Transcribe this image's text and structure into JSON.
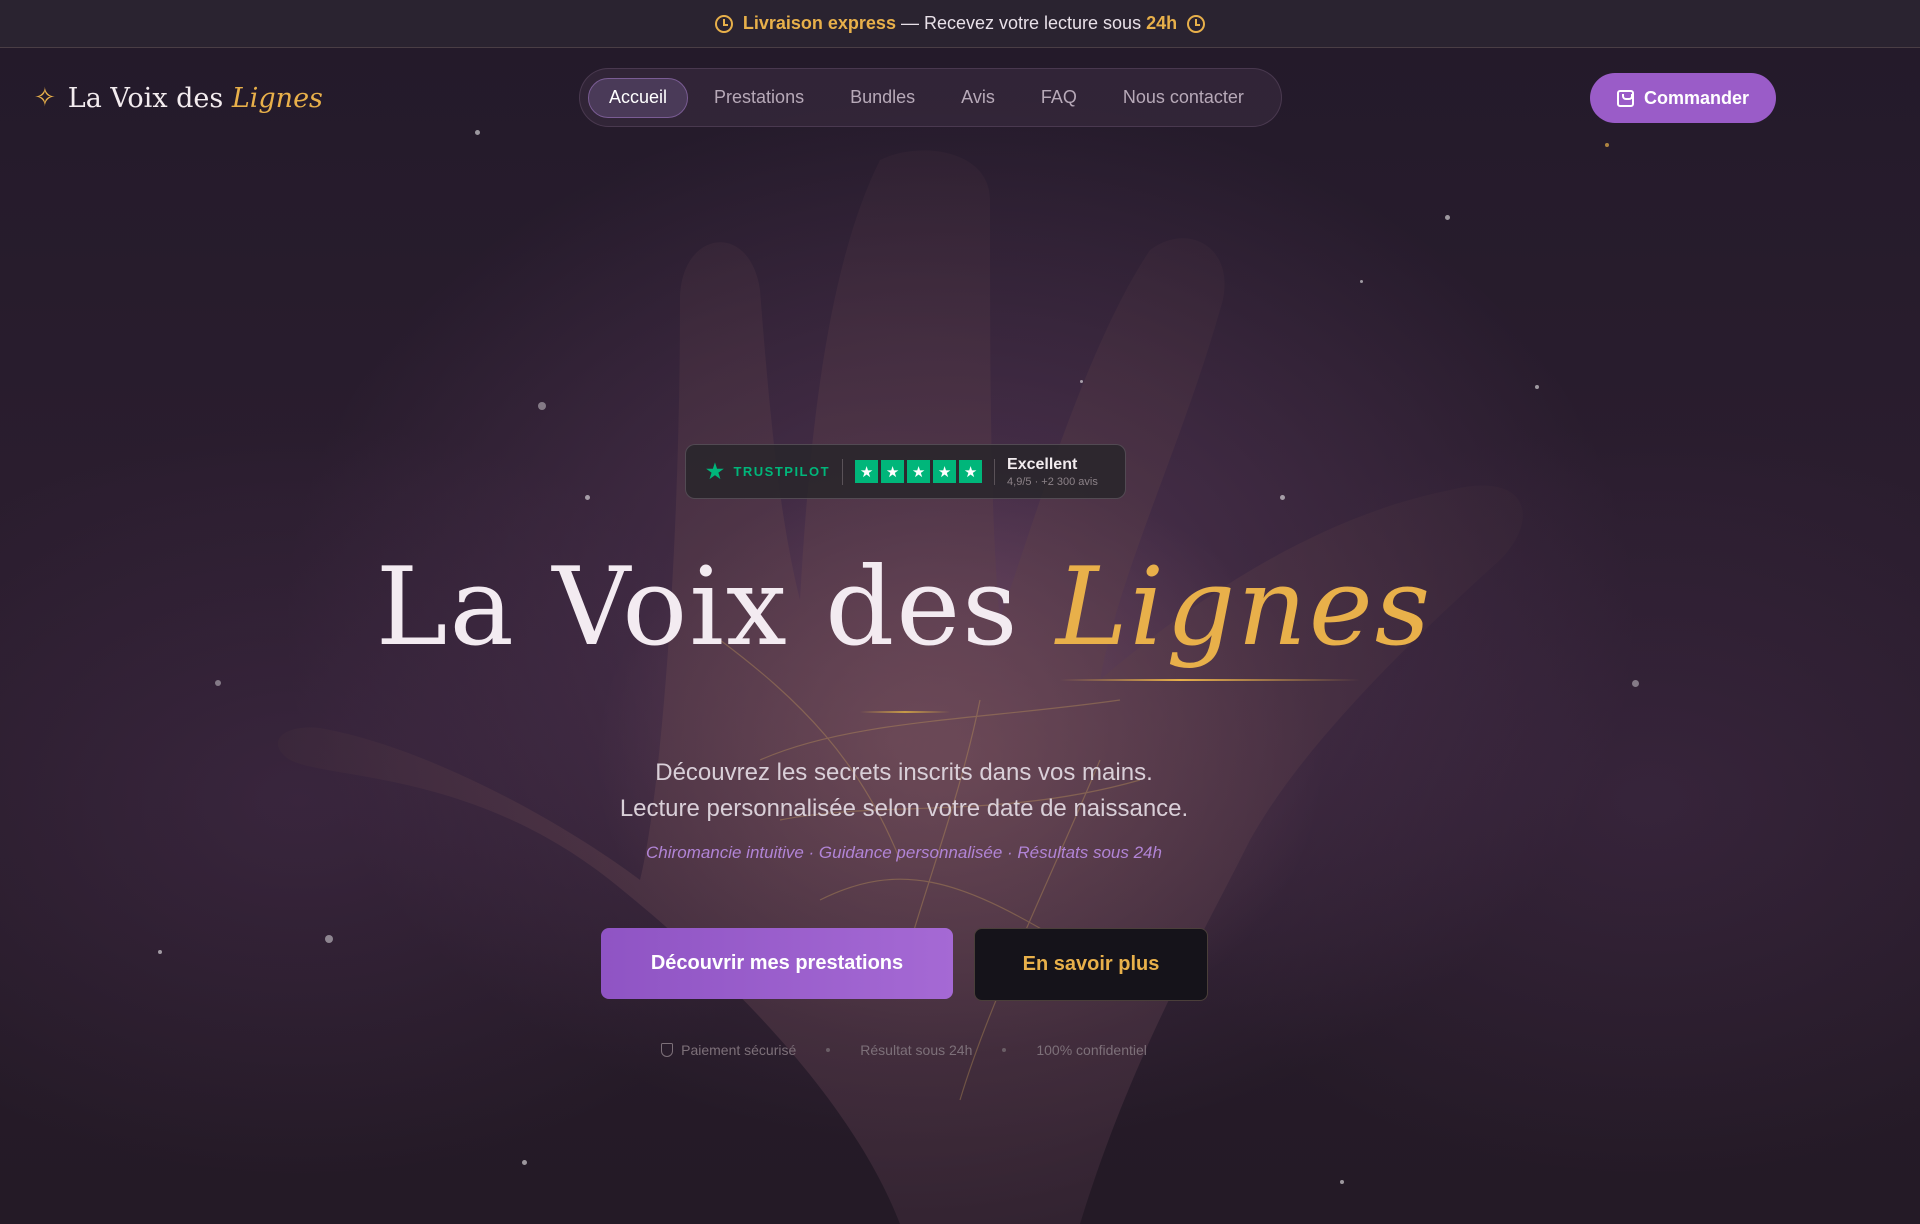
{
  "announcement": {
    "highlight": "Livraison express",
    "text": " — Recevez votre lecture sous ",
    "time": "24h"
  },
  "brand": {
    "name_main": "La Voix des ",
    "name_accent": "Lignes"
  },
  "nav": {
    "items": [
      {
        "label": "Accueil",
        "active": true
      },
      {
        "label": "Prestations",
        "active": false
      },
      {
        "label": "Bundles",
        "active": false
      },
      {
        "label": "Avis",
        "active": false
      },
      {
        "label": "FAQ",
        "active": false
      },
      {
        "label": "Nous contacter",
        "active": false
      }
    ]
  },
  "header_cta": {
    "label": "Commander"
  },
  "trustpilot": {
    "brand": "TRUSTPILOT",
    "rating_label": "Excellent",
    "rating_detail": "4,9/5 · +2 300 avis",
    "stars": 5
  },
  "hero": {
    "title_main": "La Voix des ",
    "title_accent": "Lignes",
    "subtitle_line1": "Découvrez les secrets inscrits dans vos mains.",
    "subtitle_line2": "Lecture personnalisée selon votre date de naissance.",
    "tagline": "Chiromancie intuitive · Guidance personnalisée · Résultats sous 24h",
    "primary_button": "Découvrir mes prestations",
    "secondary_button": "En savoir plus"
  },
  "assurances": [
    "Paiement sécurisé",
    "Résultat sous 24h",
    "100% confidentiel"
  ],
  "colors": {
    "accent_gold": "#e8b04a",
    "accent_purple": "#9a5cc8",
    "trustpilot_green": "#00b67a",
    "background": "#1d1420"
  }
}
